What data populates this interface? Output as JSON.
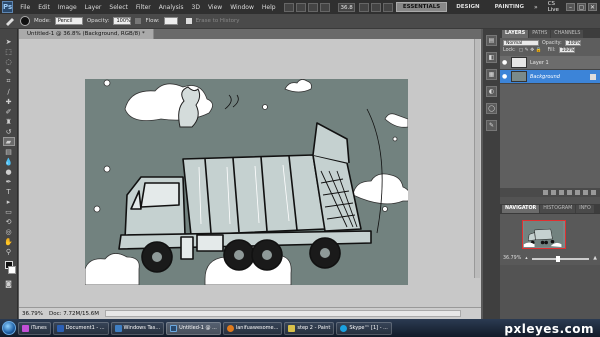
{
  "menubar": {
    "logo": "Ps",
    "items": [
      "File",
      "Edit",
      "Image",
      "Layer",
      "Select",
      "Filter",
      "Analysis",
      "3D",
      "View",
      "Window",
      "Help"
    ],
    "zoom": "36.8",
    "workspaces": [
      "ESSENTIALS",
      "DESIGN",
      "PAINTING"
    ],
    "more": "»",
    "cslive": "CS Live",
    "controls": [
      "–",
      "▢",
      "✕"
    ]
  },
  "options": {
    "mode_label": "Mode:",
    "mode_value": "Pencil",
    "opacity_label": "Opacity:",
    "opacity_value": "100%",
    "flow_label": "Flow:",
    "erase_label": "Erase to History"
  },
  "document": {
    "tab_title": "Untitled-1 @ 36.8% (Background, RGB/8) *",
    "zoom": "36.79%",
    "doc_size": "Doc: 7.72M/15.6M"
  },
  "panels": {
    "layers_tabs": [
      "LAYERS",
      "PATHS",
      "CHANNELS"
    ],
    "blend_mode": "Normal",
    "opacity_label": "Opacity:",
    "opacity_value": "100%",
    "lock_label": "Lock:",
    "fill_label": "Fill:",
    "fill_value": "100%",
    "layers": [
      {
        "name": "Layer 1"
      },
      {
        "name": "Background"
      }
    ],
    "nav_tabs": [
      "NAVIGATOR",
      "HISTOGRAM",
      "INFO"
    ],
    "nav_zoom": "36.79%"
  },
  "taskbar": {
    "items": [
      {
        "label": "iTunes",
        "color": "#c24fd6"
      },
      {
        "label": "Document1 - ...",
        "color": "#2b5fb4"
      },
      {
        "label": "Windows Tas...",
        "color": "#3f7fc4"
      },
      {
        "label": "Untitled-1 @ ...",
        "color": "#2a4a6e"
      },
      {
        "label": "lanifuawesome...",
        "color": "#e07a1c"
      },
      {
        "label": "step 2 - Paint",
        "color": "#d8c04a"
      },
      {
        "label": "Skype™ [1] - ...",
        "color": "#1aa1e0"
      }
    ]
  },
  "watermark": "pxleyes.com"
}
